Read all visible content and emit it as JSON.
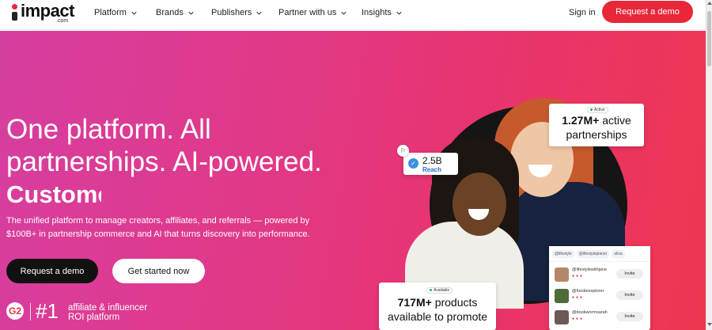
{
  "header": {
    "logo_word": "impact",
    "logo_sub": ".com",
    "nav": [
      {
        "label": "Platform"
      },
      {
        "label": "Brands"
      },
      {
        "label": "Publishers"
      },
      {
        "label": "Partner with us"
      },
      {
        "label": "Insights"
      }
    ],
    "signin": "Sign in",
    "cta": "Request a demo"
  },
  "hero": {
    "headline": "One platform. All partnerships. AI-powered.",
    "rotating_word": "Custome",
    "subtext": "The unified platform to manage creators, affiliates, and referrals — powered by $100B+ in partnership commerce and AI that turns discovery into performance.",
    "primary_cta": "Request a demo",
    "secondary_cta": "Get started now",
    "award": {
      "badge": "G2",
      "rank": "#1",
      "line1": "affiliate & influencer",
      "line2": "ROI platform"
    }
  },
  "visual": {
    "partnerships_card": {
      "status": "Active",
      "value": "1.27M+",
      "line1": "active",
      "line2": "partnerships"
    },
    "reach_card": {
      "value": "2.5B",
      "label": "Reach"
    },
    "products_card": {
      "status": "Available",
      "value": "717M+",
      "line1": "products",
      "line2": "available to promote"
    },
    "creator_panel": {
      "tags": [
        "@lifestyle",
        "@lifestyleplaner",
        "eliza"
      ],
      "creators": [
        {
          "handle": "@lifestylewithjane",
          "invite": "Invite"
        },
        {
          "handle": "@foodieexplorer",
          "invite": "Invite"
        },
        {
          "handle": "@bookwormsarah",
          "invite": "Invite"
        }
      ]
    }
  },
  "colors": {
    "brand_red": "#e8283a",
    "gradient_start": "#d63ea0",
    "gradient_end": "#ef3650"
  }
}
